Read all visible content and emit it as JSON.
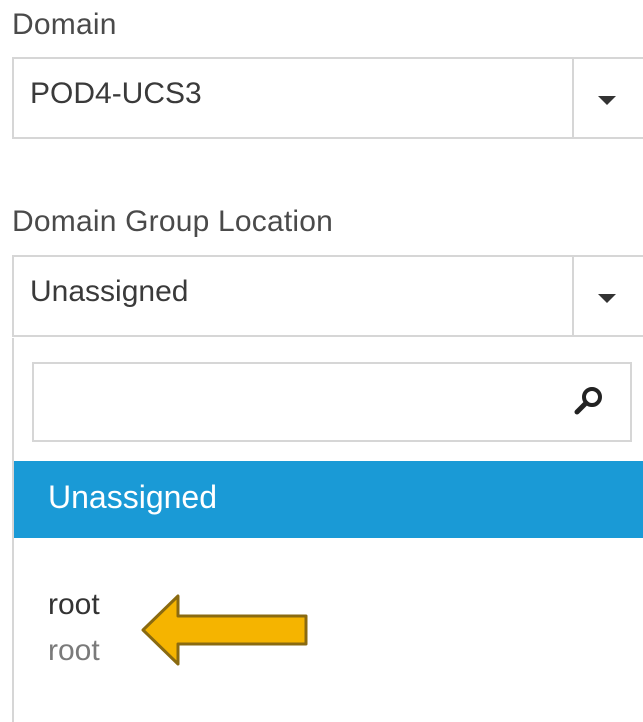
{
  "domain": {
    "label": "Domain",
    "selected_value": "POD4-UCS3"
  },
  "domain_group_location": {
    "label": "Domain Group Location",
    "selected_value": "Unassigned",
    "dropdown": {
      "search_value": "",
      "options": [
        {
          "label": "Unassigned",
          "selected": true
        },
        {
          "label": "root",
          "sublabel": "root",
          "selected": false
        }
      ]
    }
  },
  "colors": {
    "selected_option_bg": "#1a9ad6",
    "annotation_arrow": "#f5b400"
  },
  "icons": {
    "dropdown_toggle": "chevron-down-icon",
    "search": "search-icon",
    "annotation": "arrow-left-icon"
  }
}
